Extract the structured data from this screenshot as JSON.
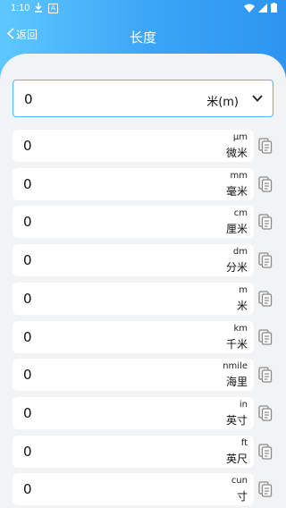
{
  "status": {
    "time": "1:10"
  },
  "nav": {
    "back_label": "返回",
    "title": "长度"
  },
  "selector": {
    "value": "0",
    "unit": "米(m)"
  },
  "units": [
    {
      "value": "0",
      "symbol": "μm",
      "name": "微米"
    },
    {
      "value": "0",
      "symbol": "mm",
      "name": "毫米"
    },
    {
      "value": "0",
      "symbol": "cm",
      "name": "厘米"
    },
    {
      "value": "0",
      "symbol": "dm",
      "name": "分米"
    },
    {
      "value": "0",
      "symbol": "m",
      "name": "米"
    },
    {
      "value": "0",
      "symbol": "km",
      "name": "千米"
    },
    {
      "value": "0",
      "symbol": "nmile",
      "name": "海里"
    },
    {
      "value": "0",
      "symbol": "in",
      "name": "英寸"
    },
    {
      "value": "0",
      "symbol": "ft",
      "name": "英尺"
    },
    {
      "value": "0",
      "symbol": "cun",
      "name": "寸"
    }
  ],
  "colors": {
    "header": "#3aa4f6",
    "border": "#59b4f4",
    "background": "#f2f3f5"
  }
}
